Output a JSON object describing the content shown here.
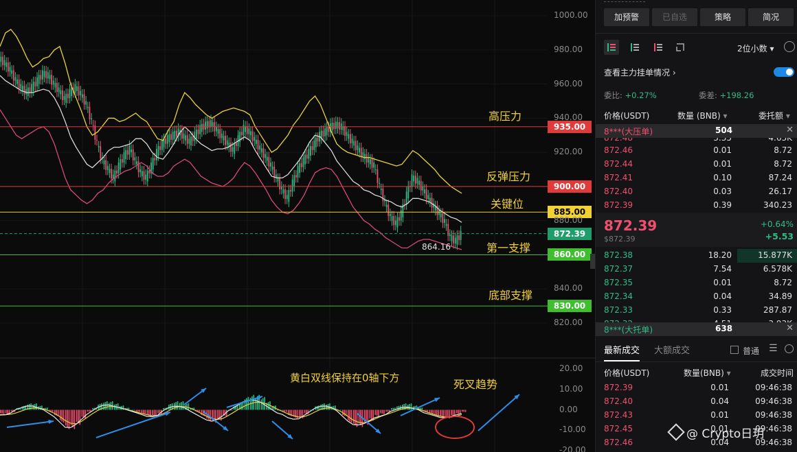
{
  "price_axis": {
    "ticks": [
      {
        "label": "1000.00",
        "value": 1000
      },
      {
        "label": "980.00",
        "value": 980
      },
      {
        "label": "960.00",
        "value": 960
      },
      {
        "label": "940.00",
        "value": 940
      },
      {
        "label": "920.00",
        "value": 920
      },
      {
        "label": "880.00",
        "value": 880
      },
      {
        "label": "840.00",
        "value": 840
      },
      {
        "label": "820.00",
        "value": 820
      }
    ]
  },
  "levels": [
    {
      "label": "935.00",
      "value": 935,
      "line_color": "#e03a3a",
      "tag_bg": "#e03a3a",
      "tag_color": "#ffffff",
      "annotation": "高压力"
    },
    {
      "label": "900.00",
      "value": 900,
      "line_color": "#e03a3a",
      "tag_bg": "#e03a3a",
      "tag_color": "#ffffff",
      "annotation": "反弹压力"
    },
    {
      "label": "885.00",
      "value": 885,
      "line_color": "#f2d231",
      "tag_bg": "#f2d231",
      "tag_color": "#000000",
      "annotation": "关键位"
    },
    {
      "label": "860.00",
      "value": 860,
      "line_color": "#3fbf2f",
      "tag_bg": "#3fbf2f",
      "tag_color": "#ffffff",
      "annotation": "第一支撑"
    },
    {
      "label": "830.00",
      "value": 830,
      "line_color": "#3fbf2f",
      "tag_bg": "#3fbf2f",
      "tag_color": "#ffffff",
      "annotation": "底部支撑"
    }
  ],
  "current_price_tag": {
    "label": "872.39",
    "value": 872.39,
    "bg": "#1f9e6b"
  },
  "low_marker": {
    "label": "864.16"
  },
  "macd": {
    "ticks": [
      {
        "label": "20.00",
        "value": 20
      },
      {
        "label": "10.00",
        "value": 10
      },
      {
        "label": "0.00",
        "value": 0
      },
      {
        "label": "-10.00",
        "value": -10
      },
      {
        "label": "-20.00",
        "value": -20
      }
    ],
    "annotation_1": "黄白双线保持在0轴下方",
    "annotation_2": "死叉趋势"
  },
  "chart_data": {
    "type": "line",
    "close": [
      975,
      972,
      968,
      962,
      958,
      955,
      958,
      962,
      966,
      965,
      960,
      956,
      951,
      955,
      958,
      954,
      948,
      938,
      925,
      915,
      910,
      905,
      912,
      918,
      922,
      915,
      908,
      905,
      912,
      920,
      925,
      928,
      930,
      932,
      929,
      926,
      930,
      934,
      936,
      937,
      933,
      929,
      925,
      921,
      928,
      934,
      932,
      927,
      922,
      917,
      912,
      905,
      898,
      893,
      902,
      910,
      915,
      920,
      925,
      930,
      932,
      935,
      936,
      935,
      930,
      926,
      922,
      918,
      915,
      912,
      900,
      890,
      882,
      878,
      884,
      895,
      905,
      903,
      898,
      893,
      888,
      884,
      879,
      870,
      868,
      872
    ],
    "upper_band": [
      982,
      990,
      992,
      988,
      982,
      975,
      970,
      972,
      975,
      976,
      980,
      982,
      972,
      960,
      952,
      944,
      935,
      930,
      932,
      936,
      940,
      940,
      938,
      939,
      941,
      943,
      940,
      938,
      933,
      928,
      927,
      933,
      938,
      948,
      955,
      952,
      948,
      945,
      942,
      940,
      942,
      944,
      945,
      946,
      945,
      944,
      942,
      935,
      930,
      925,
      920,
      922,
      926,
      930,
      936,
      940,
      945,
      950,
      953,
      948,
      940,
      932,
      925,
      922,
      920,
      919,
      918,
      917,
      917,
      916,
      915,
      914,
      913,
      912,
      913,
      917,
      921,
      919,
      916,
      913,
      910,
      906,
      903,
      900,
      898,
      896
    ],
    "lower_band": [
      945,
      940,
      935,
      930,
      928,
      930,
      932,
      934,
      935,
      932,
      925,
      915,
      905,
      898,
      895,
      892,
      890,
      892,
      896,
      898,
      902,
      905,
      907,
      909,
      910,
      912,
      914,
      912,
      908,
      906,
      906,
      908,
      912,
      914,
      916,
      914,
      910,
      906,
      904,
      902,
      901,
      900,
      902,
      905,
      910,
      914,
      912,
      908,
      903,
      898,
      892,
      888,
      885,
      884,
      886,
      890,
      895,
      902,
      908,
      910,
      911,
      910,
      906,
      900,
      894,
      888,
      884,
      880,
      878,
      875,
      873,
      870,
      868,
      866,
      864,
      864,
      866,
      868,
      869,
      869,
      868,
      867,
      866,
      865,
      864,
      863
    ],
    "mid_band": [
      965,
      962,
      960,
      958,
      956,
      955,
      955,
      956,
      957,
      956,
      952,
      946,
      938,
      929,
      923,
      918,
      913,
      911,
      914,
      917,
      921,
      923,
      923,
      924,
      925,
      928,
      928,
      925,
      920,
      917,
      916,
      920,
      925,
      931,
      935,
      932,
      928,
      925,
      923,
      921,
      922,
      922,
      923,
      925,
      927,
      929,
      927,
      921,
      916,
      911,
      906,
      905,
      905,
      907,
      911,
      915,
      920,
      926,
      930,
      929,
      925,
      921,
      915,
      911,
      907,
      903,
      901,
      898,
      897,
      895,
      894,
      892,
      891,
      889,
      888,
      890,
      893,
      893,
      892,
      891,
      889,
      886,
      884,
      882,
      881,
      879
    ],
    "macd_hist": [
      -2,
      -2,
      -1,
      1,
      2,
      3,
      3,
      2,
      1,
      -1,
      -3,
      -6,
      -9,
      -9,
      -7,
      -4,
      -1,
      1,
      3,
      4,
      4,
      3,
      2,
      1,
      0,
      -1,
      -2,
      -3,
      -3,
      -2,
      1,
      3,
      4,
      4,
      3,
      1,
      -1,
      -3,
      -5,
      -6,
      -5,
      -3,
      0,
      2,
      4,
      6,
      7,
      7,
      6,
      4,
      2,
      0,
      -1,
      -3,
      -4,
      -4,
      -2,
      0,
      2,
      3,
      3,
      2,
      0,
      -3,
      -6,
      -8,
      -8,
      -7,
      -5,
      -3,
      -2,
      -1,
      1,
      2,
      3,
      3,
      2,
      1,
      -1,
      -2,
      -3,
      -4,
      -4,
      -3,
      -2,
      -1
    ],
    "ylim": [
      815,
      1005
    ],
    "macd_ylim": [
      -21,
      21
    ]
  },
  "panel": {
    "buttons": [
      "加预警",
      "已自选",
      "策略",
      "简况"
    ],
    "decimals": "2位小数",
    "main_orders_link": "查看主力挂单情况",
    "ratio_label": "委比:",
    "ratio_value": "+0.27%",
    "diff_label": "委差:",
    "diff_value": "+198.26",
    "headers": {
      "price": "价格(USDT)",
      "qty": "数量 (BNB)",
      "total": "委托额"
    },
    "big_sell_label": "8***(大压单)",
    "big_sell_qty": "504",
    "asks": [
      {
        "price": "872.48",
        "qty": "3.35",
        "total": "4.63K"
      },
      {
        "price": "872.46",
        "qty": "0.01",
        "total": "8.72"
      },
      {
        "price": "872.44",
        "qty": "0.01",
        "total": "8.72"
      },
      {
        "price": "872.41",
        "qty": "0.10",
        "total": "87.24"
      },
      {
        "price": "872.40",
        "qty": "0.03",
        "total": "26.17"
      },
      {
        "price": "872.39",
        "qty": "0.39",
        "total": "340.23"
      }
    ],
    "last_price": "872.39",
    "last_price_usd": "$872.39",
    "change_pct": "+0.64%",
    "change_abs": "+5.53",
    "bids": [
      {
        "price": "872.38",
        "qty": "18.20",
        "total": "15.877K"
      },
      {
        "price": "872.37",
        "qty": "7.54",
        "total": "6.578K"
      },
      {
        "price": "872.35",
        "qty": "0.01",
        "total": "8.72"
      },
      {
        "price": "872.34",
        "qty": "0.04",
        "total": "34.89"
      },
      {
        "price": "872.33",
        "qty": "0.33",
        "total": "287.87"
      },
      {
        "price": "872.32",
        "qty": "4.51",
        "total": "3.93K"
      }
    ],
    "big_buy_label": "8***(大托单)",
    "big_buy_qty": "638",
    "tabs": [
      "最新成交",
      "大额成交"
    ],
    "checkbox_label": "普通",
    "trade_headers": {
      "price": "价格(USDT)",
      "qty": "数量(BNB)",
      "time": "成交时间"
    },
    "trades": [
      {
        "price": "872.39",
        "qty": "0.01",
        "time": "09:46:38"
      },
      {
        "price": "872.40",
        "qty": "0.04",
        "time": "09:46:38"
      },
      {
        "price": "872.43",
        "qty": "0.01",
        "time": "09:46:38"
      },
      {
        "price": "872.45",
        "qty": "0.01",
        "time": "09:46:38"
      },
      {
        "price": "872.46",
        "qty": "0.04",
        "time": "09:46:38"
      }
    ]
  },
  "watermark": "@ Crypto日玥"
}
